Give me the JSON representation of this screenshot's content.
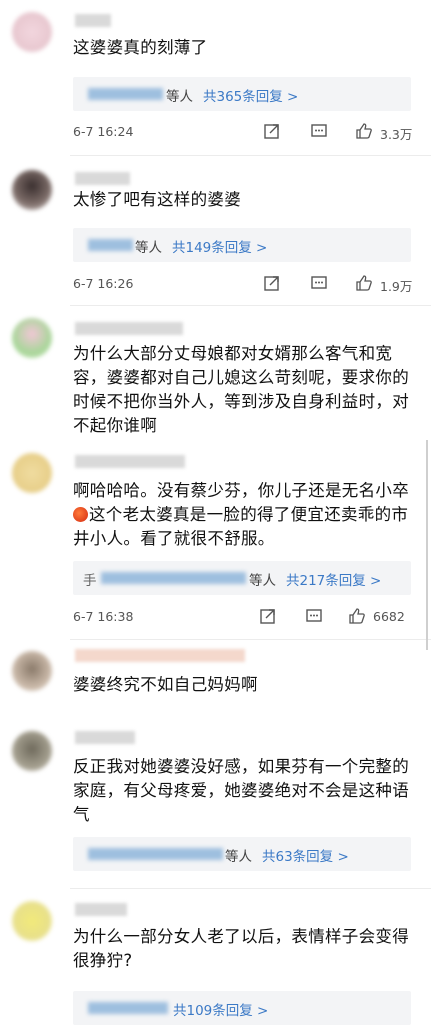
{
  "comments": [
    {
      "text": "这婆婆真的刻薄了",
      "reply_suffix": "等人",
      "reply_count": "共365条回复 >",
      "time": "6-7 16:24",
      "likes": "3.3万"
    },
    {
      "text": "太惨了吧有这样的婆婆",
      "reply_suffix": "等人",
      "reply_count": "共149条回复 >",
      "time": "6-7 16:26",
      "likes": "1.9万"
    },
    {
      "text": "为什么大部分丈母娘都对女婿那么客气和宽容，婆婆都对自己儿媳这么苛刻呢，要求你的时候不把你当外人，等到涉及自身利益时，对不起你谁啊"
    },
    {
      "text_before": "啊哈哈哈。没有蔡少芬，你儿子还是无名小卒",
      "text_after": "这个老太婆真是一脸的得了便宜还卖乖的市井小人。看了就很不舒服。",
      "reply_prefix": "手",
      "reply_suffix": "等人",
      "reply_count": "共217条回复 >",
      "time": "6-7 16:38",
      "likes": "6682"
    },
    {
      "text": "婆婆终究不如自己妈妈啊"
    },
    {
      "text": "反正我对她婆婆没好感，如果芬有一个完整的家庭，有父母疼爱，她婆婆绝对不会是这种语气",
      "reply_suffix": "等人",
      "reply_count": "共63条回复 >"
    },
    {
      "text": "为什么一部分女人老了以后，表情样子会变得很狰狞?",
      "reply_count": "共109条回复 >"
    }
  ],
  "icons": {
    "share": "share-icon",
    "comment": "comment-icon",
    "like": "thumbs-up-icon",
    "emoji": "tomato-emoji-icon"
  }
}
